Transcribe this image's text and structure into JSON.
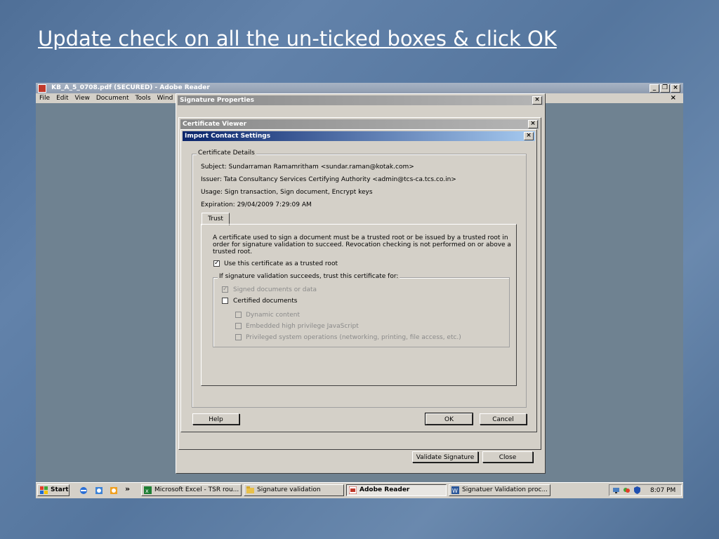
{
  "slide": {
    "title": "Update check on all the un-ticked boxes & click OK"
  },
  "reader": {
    "title": "KB_A_5_0708.pdf (SECURED) - Adobe Reader",
    "controls": {
      "minimize": "_",
      "restore": "❐",
      "close": "×"
    },
    "menu": [
      "File",
      "Edit",
      "View",
      "Document",
      "Tools",
      "Wind"
    ],
    "doc_close": "×"
  },
  "signature_properties": {
    "title": "Signature Properties",
    "validate_label": "Validate Signature",
    "close_label": "Close"
  },
  "certificate_viewer": {
    "title": "Certificate Viewer"
  },
  "import_dialog": {
    "title": "Import Contact Settings",
    "close": "×",
    "details_label": "Certificate Details",
    "subject": "Subject:   Sundarraman Ramamritham <sundar.raman@kotak.com>",
    "issuer": "Issuer:   Tata Consultancy Services Certifying Authority <admin@tcs-ca.tcs.co.in>",
    "usage": "Usage:   Sign transaction, Sign document, Encrypt keys",
    "expiration": "Expiration:   29/04/2009 7:29:09 AM",
    "tab_trust": "Trust",
    "trust_line1": "A certificate used to sign a document must be a trusted root or be issued by a trusted root in",
    "trust_line2": "order for signature validation to succeed.  Revocation checking is not performed on or above a",
    "trust_line3": "trusted root.",
    "use_trusted_root": "Use this certificate as a trusted root",
    "trust_group_label": "If signature validation succeeds, trust this certificate for:",
    "signed_docs": "Signed documents or data",
    "certified_docs": "Certified documents",
    "dynamic_content": "Dynamic content",
    "embedded_js": "Embedded high privilege JavaScript",
    "privileged_ops": "Privileged system operations (networking, printing, file access, etc.)",
    "check_mark": "✓",
    "help_label": "Help",
    "ok_label": "OK",
    "cancel_label": "Cancel"
  },
  "taskbar": {
    "start": "Start",
    "chevron": "»",
    "items": [
      "Microsoft Excel - TSR rou...",
      "Signature validation",
      "Adobe Reader",
      "Signatuer Validation proc..."
    ],
    "time": "8:07 PM"
  }
}
